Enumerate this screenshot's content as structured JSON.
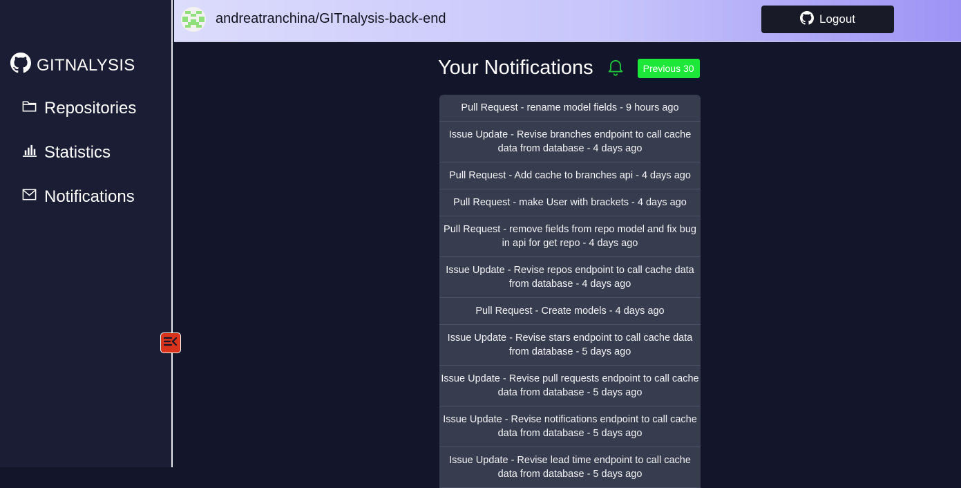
{
  "sidebar": {
    "brand": "GITNALYSIS",
    "items": [
      {
        "label": "Repositories",
        "icon": "folder-icon"
      },
      {
        "label": "Statistics",
        "icon": "bar-chart-icon"
      },
      {
        "label": "Notifications",
        "icon": "mail-icon"
      }
    ],
    "collapse_icon": "collapse-sidebar-icon"
  },
  "header": {
    "repo": "andreatranchina/GITnalysis-back-end",
    "logout_label": "Logout"
  },
  "main": {
    "title": "Your Notifications",
    "previous_label": "Previous 30"
  },
  "notifications": [
    "Pull Request - rename model fields - 9 hours ago",
    "Issue Update - Revise branches endpoint to call cache data from database - 4 days ago",
    "Pull Request - Add cache to branches api - 4 days ago",
    "Pull Request - make User with brackets - 4 days ago",
    "Pull Request - remove fields from repo model and fix bug in api for get repo - 4 days ago",
    "Issue Update - Revise repos endpoint to call cache data from database - 4 days ago",
    "Pull Request - Create models - 4 days ago",
    "Issue Update - Revise stars endpoint to call cache data from database - 5 days ago",
    "Issue Update - Revise pull requests endpoint to call cache data from database - 5 days ago",
    "Issue Update - Revise notifications endpoint to call cache data from database - 5 days ago",
    "Issue Update - Revise lead time endpoint to call cache data from database - 5 days ago"
  ],
  "colors": {
    "background": "#13162a",
    "sidebar": "#1a1d33",
    "accent_green": "#1de83a",
    "collapse_red": "#d9331c"
  }
}
